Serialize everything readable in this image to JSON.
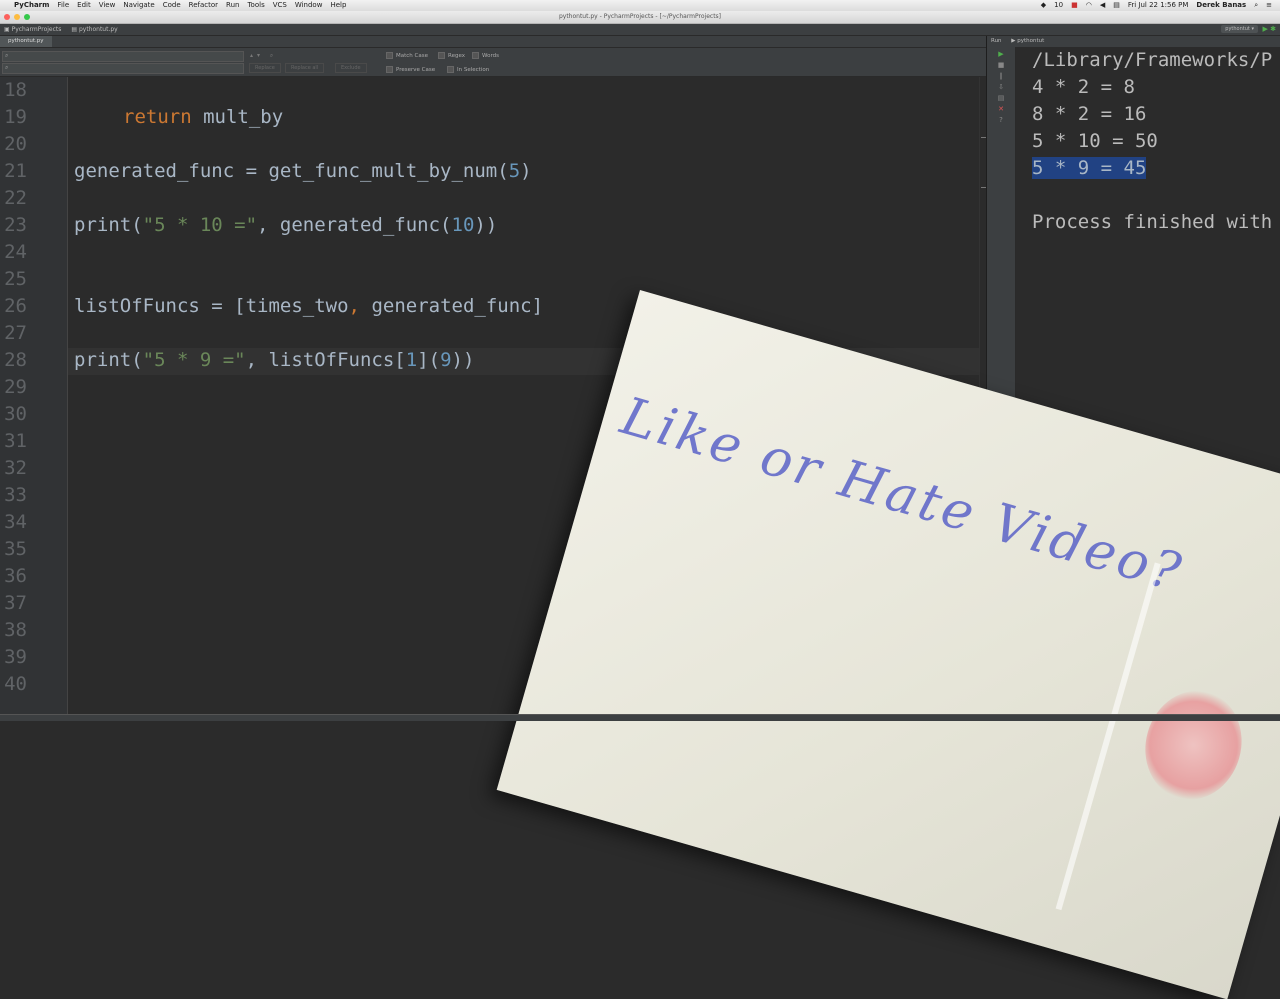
{
  "menubar": {
    "app_name": "PyCharm",
    "items": [
      "File",
      "Edit",
      "View",
      "Navigate",
      "Code",
      "Refactor",
      "Run",
      "Tools",
      "VCS",
      "Window",
      "Help"
    ],
    "battery": "10",
    "datetime": "Fri Jul 22  1:56 PM",
    "user": "Derek Banas"
  },
  "window": {
    "title": "pythontut.py - PycharmProjects - [~/PycharmProjects]"
  },
  "navbar": {
    "project": "PycharmProjects",
    "file": "pythontut.py",
    "run_config": "pythontut"
  },
  "tabs": [
    {
      "label": "pythontut.py"
    }
  ],
  "find": {
    "match_case": "Match Case",
    "regex": "Regex",
    "words": "Words",
    "preserve_case": "Preserve Case",
    "in_selection": "In Selection",
    "replace": "Replace",
    "replace_all": "Replace all",
    "exclude": "Exclude"
  },
  "editor": {
    "line_numbers": [
      "18",
      "19",
      "20",
      "21",
      "22",
      "23",
      "24",
      "25",
      "26",
      "27",
      "28",
      "29",
      "30",
      "31",
      "32",
      "33",
      "34",
      "35",
      "36",
      "37",
      "38",
      "39",
      "40"
    ],
    "line19": {
      "kw": "return",
      "rest": " mult_by"
    },
    "line21": {
      "a": "generated_func = get_func_mult_by_num(",
      "num": "5",
      "b": ")"
    },
    "line23": {
      "a": "print(",
      "str": "\"5 * 10 =\"",
      "b": ", generated_func(",
      "num": "10",
      "c": "))"
    },
    "line26": {
      "a": "listOfFuncs = [times_two",
      "b": ", ",
      "c": "generated_func]"
    },
    "line28": {
      "a": "print(",
      "str": "\"5 * 9 =\"",
      "b": ", listOfFuncs[",
      "num1": "1",
      "c": "](",
      "num2": "9",
      "d": "))"
    }
  },
  "run": {
    "header_label": "Run",
    "tab_label": "pythontut",
    "lines": [
      "/Library/Frameworks/P",
      "4 * 2 = 8",
      "8 * 2 = 16",
      "5 * 10 = 50",
      "5 * 9 = 45",
      "Process finished with"
    ]
  },
  "overlay": {
    "card_text": "Like or Hate Video?"
  }
}
